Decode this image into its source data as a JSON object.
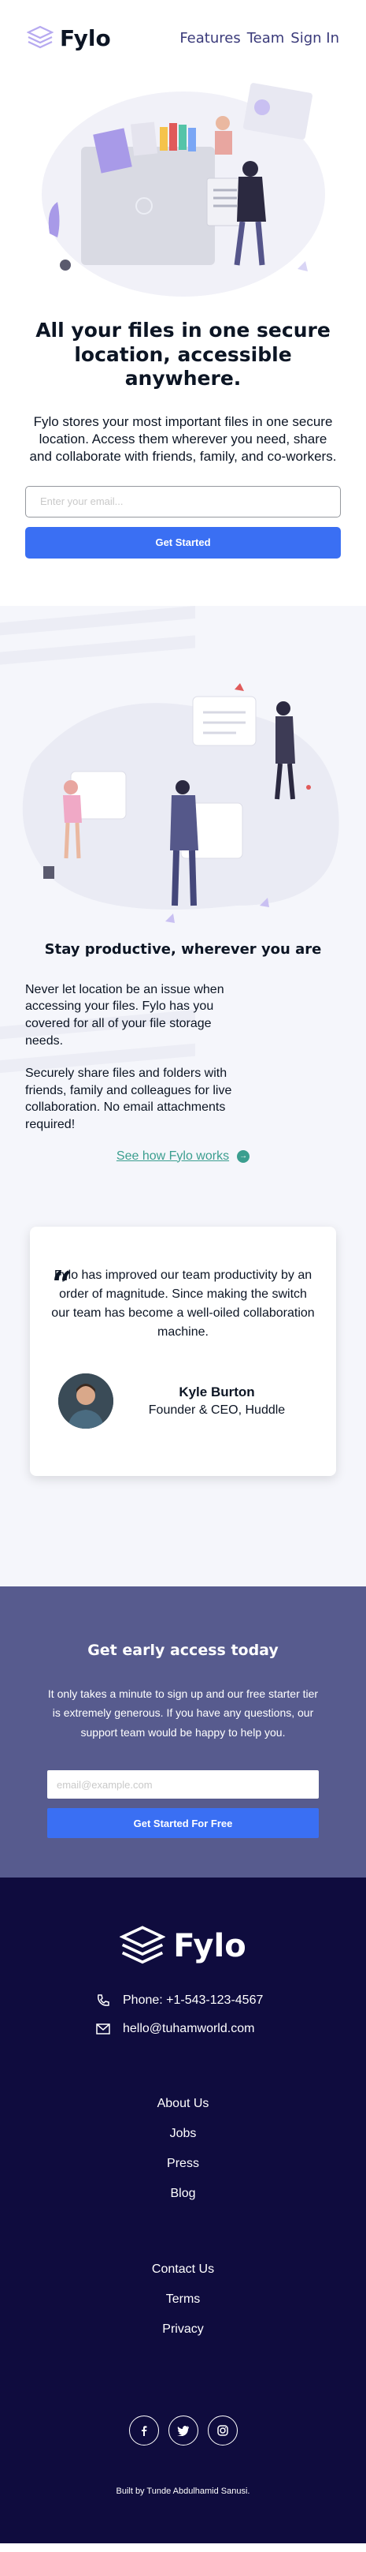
{
  "header": {
    "logo_text": "Fylo",
    "nav": [
      "Features",
      "Team",
      "Sign In"
    ]
  },
  "hero": {
    "title": "All your files in one secure location, accessible anywhere.",
    "description": "Fylo stores your most important files in one secure location. Access them wherever you need, share and collaborate with friends, family, and co-workers.",
    "email_placeholder": "Enter your email...",
    "cta_label": "Get Started"
  },
  "productive": {
    "title": "Stay productive, wherever you are",
    "paragraphs": [
      "Never let location be an issue when accessing your files. Fylo has you covered for all of your file storage needs.",
      "Securely share files and folders with friends, family and colleagues for live collaboration. No email attachments required!"
    ],
    "link_label": "See how Fylo works"
  },
  "testimonial": {
    "quote": "Fylo has improved our team productivity by an order of magnitude. Since making the switch our team has become a well-oiled collaboration machine.",
    "name": "Kyle Burton",
    "title": "Founder & CEO, Huddle"
  },
  "early_access": {
    "title": "Get early access today",
    "description": "It only takes a minute to sign up and our free starter tier is extremely generous. If you have any questions, our support team would be happy to help you.",
    "email_placeholder": "email@example.com",
    "cta_label": "Get Started For Free"
  },
  "footer": {
    "logo_text": "Fylo",
    "phone": "Phone: +1-543-123-4567",
    "email": "hello@tuhamworld.com",
    "links_1": [
      "About Us",
      "Jobs",
      "Press",
      "Blog"
    ],
    "links_2": [
      "Contact Us",
      "Terms",
      "Privacy"
    ],
    "socials": [
      "facebook-icon",
      "twitter-icon",
      "instagram-icon"
    ],
    "credit": "Built by Tunde Abdulhamid Sanusi."
  },
  "colors": {
    "accent_blue": "#3a6ff3",
    "link_teal": "#3b9e8f",
    "early_bg": "#575b8e",
    "footer_bg": "#0f0c3e"
  }
}
